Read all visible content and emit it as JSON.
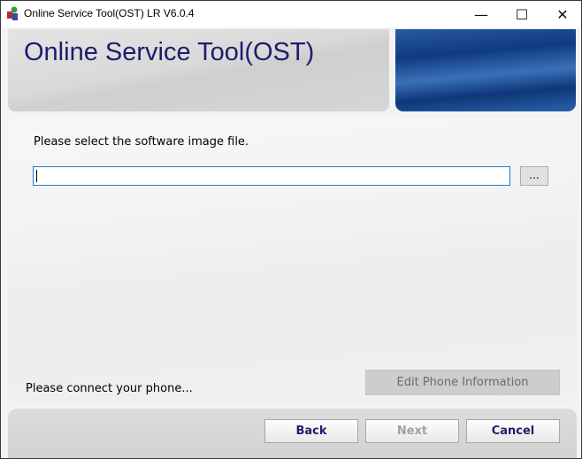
{
  "window": {
    "title": "Online Service Tool(OST) LR V6.0.4",
    "minimize": "—",
    "maximize": "☐",
    "close": "✕"
  },
  "header": {
    "title": "Online Service Tool(OST)"
  },
  "main": {
    "prompt": "Please select the software image file.",
    "file_value": "",
    "browse_label": "...",
    "status": "Please connect your phone...",
    "edit_phone_label": "Edit Phone Information"
  },
  "footer": {
    "back": "Back",
    "next": "Next",
    "cancel": "Cancel"
  }
}
